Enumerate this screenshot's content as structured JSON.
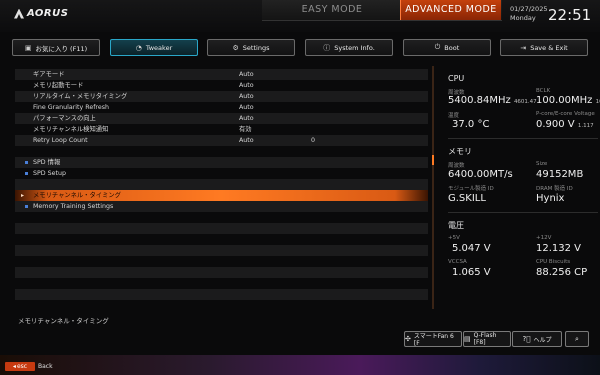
{
  "header": {
    "logo": "AORUS",
    "mode_easy": "EASY MODE",
    "mode_advanced": "ADVANCED MODE",
    "date": "01/27/2025",
    "day": "Monday",
    "time": "22:51",
    "accent_color": "#d9541a"
  },
  "tabs": [
    {
      "label": "お気に入り (F11)",
      "icon": "favorites-icon",
      "glyph": "▣",
      "active": false
    },
    {
      "label": "Tweaker",
      "icon": "speedometer-icon",
      "glyph": "◔",
      "active": true
    },
    {
      "label": "Settings",
      "icon": "gear-icon",
      "glyph": "⚙",
      "active": false
    },
    {
      "label": "System Info.",
      "icon": "info-icon",
      "glyph": "ⓘ",
      "active": false
    },
    {
      "label": "Boot",
      "icon": "power-icon",
      "glyph": "⏻",
      "active": false
    },
    {
      "label": "Save & Exit",
      "icon": "exit-icon",
      "glyph": "⇥",
      "active": false
    }
  ],
  "settings": {
    "rows": [
      {
        "label": "ギアモード",
        "value": "Auto",
        "value2": ""
      },
      {
        "label": "メモリ起動モード",
        "value": "Auto",
        "value2": ""
      },
      {
        "label": "リアルタイム・メモリタイミング",
        "value": "Auto",
        "value2": ""
      },
      {
        "label": "Fine Granularity Refresh",
        "value": "Auto",
        "value2": ""
      },
      {
        "label": "パフォーマンスの向上",
        "value": "Auto",
        "value2": ""
      },
      {
        "label": "メモリチャンネル検知通知",
        "value": "有効",
        "value2": ""
      },
      {
        "label": "Retry Loop Count",
        "value": "Auto",
        "value2": "0"
      }
    ],
    "submenus": [
      {
        "label": "SPD 情報"
      },
      {
        "label": "SPD Setup"
      }
    ],
    "selected": {
      "label": "メモリチャンネル・タイミング"
    },
    "after": [
      {
        "label": "Memory Training Settings"
      }
    ]
  },
  "info": {
    "cpu_title": "CPU",
    "freq_label": "周波数",
    "freq_value": "5400.84MHz",
    "freq_sub": "4601.47",
    "bclk_label": "BCLK",
    "bclk_value": "100.00MHz",
    "bclk_sub": "100",
    "temp_label": "温度",
    "temp_value": "37.0 °C",
    "vcore_label": "P-core/E-core Voltage",
    "vcore_value": "0.900 V",
    "vcore_sub": "1.117",
    "mem_title": "メモリ",
    "mem_freq_label": "周波数",
    "mem_freq_value": "6400.00MT/s",
    "mem_size_label": "Size",
    "mem_size_value": "49152MB",
    "mod_label": "モジュール製造 ID",
    "mod_value": "G.SKILL",
    "dram_label": "DRAM 製造 ID",
    "dram_value": "Hynix",
    "volt_title": "電圧",
    "v5_label": "+5V",
    "v5_value": "5.047 V",
    "v12_label": "+12V",
    "v12_value": "12.132 V",
    "vccsa_label": "VCCSA",
    "vccsa_value": "1.065 V",
    "fan_label": "CPU Biscuits",
    "fan_value": "88.256 CP"
  },
  "footer": {
    "help_text": "メモリチャンネル・タイミング",
    "smart_fan": "スマートFan 6 [F",
    "qflash": "Q-Flash [F8]",
    "help": "ヘルプ",
    "esc": "esc",
    "back": "Back"
  }
}
